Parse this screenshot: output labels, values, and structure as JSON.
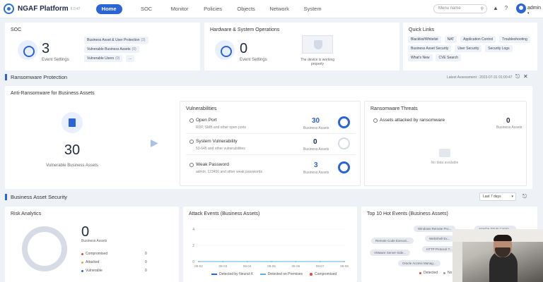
{
  "nav": {
    "brand": "NGAF Platform",
    "brand_sub": "8.0.47",
    "tabs": [
      "Home",
      "SOC",
      "Monitor",
      "Policies",
      "Objects",
      "Network",
      "System"
    ],
    "search_placeholder": "Menu name",
    "user": "admin"
  },
  "soc": {
    "title": "SOC",
    "count": "3",
    "count_label": "Event Settings",
    "tags": [
      {
        "label": "Business Asset & User Protection",
        "count": "(3)"
      },
      {
        "label": "Vulnerable Business Assets",
        "count": "(0)"
      },
      {
        "label": "Vulnerable Users",
        "count": "(0)"
      },
      {
        "label": "...",
        "count": ""
      }
    ]
  },
  "hw": {
    "title": "Hardware & System Operations",
    "count": "0",
    "count_label": "Event Settings",
    "status": "The device is working properly"
  },
  "quick_links": {
    "title": "Quick Links",
    "links": [
      "Blacklist/Whitelist",
      "NAT",
      "Application Control",
      "Troubleshooting",
      "Business Asset Security",
      "User Security",
      "Security Logs",
      "What's New",
      "CVE Search"
    ]
  },
  "ransomware": {
    "section_title": "Ransomware Protection",
    "latest_assessment": "Latest Assessment : 2023-07-31 01:00:47",
    "card_title": "Anti-Ransomware for Business Assets",
    "vuln_assets_count": "30",
    "vuln_assets_label": "Vulnerable Business Assets",
    "vulnerabilities_title": "Vulnerabilities",
    "rows": [
      {
        "title": "Open Port",
        "sub": "RDP, SMB and other open ports",
        "value": "30",
        "cap": "Business Assets",
        "color": "#2a64d6"
      },
      {
        "title": "System Vulnerability",
        "sub": "53-645 and other vulnerabilities",
        "value": "0",
        "cap": "Business Assets",
        "color": "#1f2a44"
      },
      {
        "title": "Weak Password",
        "sub": "admin, 123456 and other weak passwords",
        "value": "3",
        "cap": "Business Assets",
        "color": "#2a64d6"
      }
    ],
    "threats_title": "Ransomware Threats",
    "threat_row": {
      "title": "Assets attacked by ransomware",
      "value": "0",
      "cap": "Business Assets"
    },
    "no_data": "No data available"
  },
  "bas": {
    "section_title": "Business Asset Security",
    "period": "Last 7 days",
    "risk": {
      "title": "Risk Analytics",
      "count": "0",
      "count_label": "Business Assets",
      "legend": [
        {
          "label": "Compromised",
          "value": "0",
          "color": "#e0463d"
        },
        {
          "label": "Attacked",
          "value": "0",
          "color": "#f1a43c"
        },
        {
          "label": "Vulnerable",
          "value": "0",
          "color": "#2a64d6"
        }
      ]
    },
    "attack": {
      "title": "Attack Events (Business Assets)",
      "legend": [
        {
          "label": "Detected by Neural-X",
          "color": "#2a64d6"
        },
        {
          "label": "Detected on Premises",
          "color": "#5bb1e8"
        },
        {
          "label": "Compromised",
          "color": "#e0463d"
        }
      ]
    },
    "hot": {
      "title": "Top 10 Hot Events (Business Assets)",
      "pills": [
        "Windows Remote Pro...",
        "Apache Struts Comm...",
        "Remote Code Executi...",
        "WebShell Ex...",
        "HTTP Protocol T...",
        "VMware Server-Side...",
        "Oracle Access Manag..."
      ],
      "legend": [
        {
          "label": "Detected",
          "color": "#e0463d"
        },
        {
          "label": "No",
          "color": "#999999"
        }
      ]
    }
  },
  "chart_data": {
    "type": "line",
    "x": [
      "08-02",
      "08-03",
      "08-04",
      "08-05",
      "08-06",
      "08-07",
      "08-08"
    ],
    "ylim": [
      0,
      4
    ],
    "yticks": [
      "4",
      "2",
      "0"
    ],
    "series": [
      {
        "name": "Detected by Neural-X",
        "values": [
          0,
          0,
          0,
          0,
          0,
          0,
          0
        ]
      },
      {
        "name": "Detected on Premises",
        "values": [
          0,
          0,
          0,
          0,
          0,
          0,
          0
        ]
      }
    ]
  }
}
